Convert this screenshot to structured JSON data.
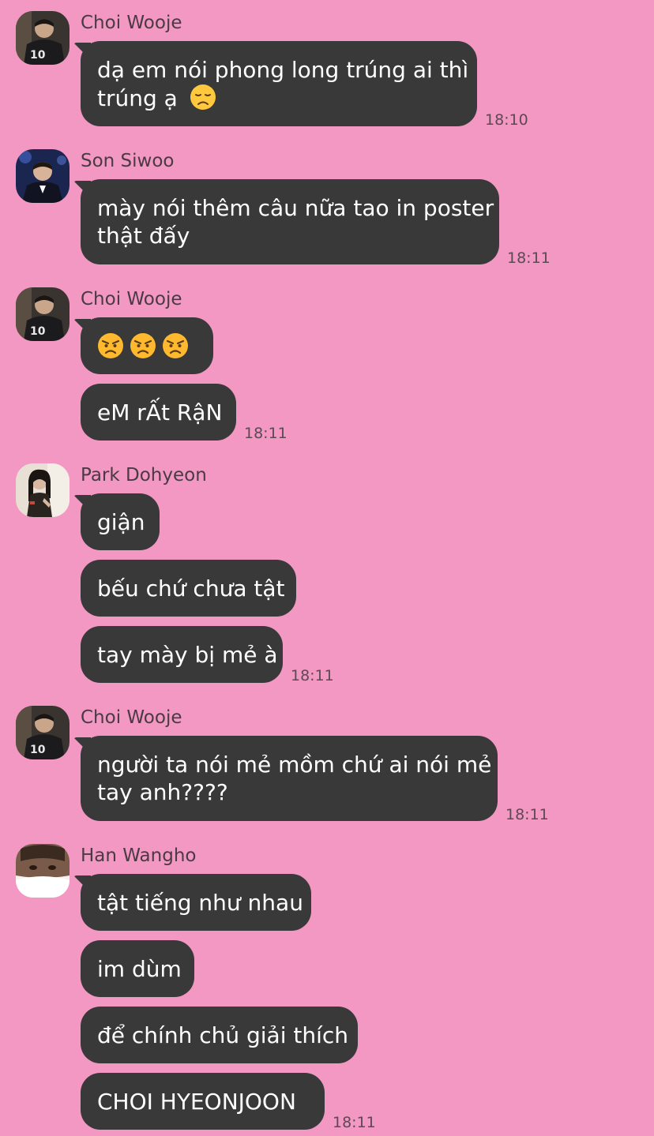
{
  "messages": [
    {
      "sender": "Choi Wooje",
      "avatar": "avatar-choi-wooje",
      "bubbles": [
        {
          "lines": [
            "dạ em nói phong long trúng ai thì",
            "trúng ạ"
          ],
          "emoji": "disappointed-face-emoji"
        }
      ],
      "time": "18:10"
    },
    {
      "sender": "Son Siwoo",
      "avatar": "avatar-son-siwoo",
      "bubbles": [
        {
          "lines": [
            "mày nói thêm câu nữa tao in poster",
            "thật đấy"
          ]
        }
      ],
      "time": "18:11"
    },
    {
      "sender": "Choi Wooje",
      "avatar": "avatar-choi-wooje",
      "bubbles": [
        {
          "lines": [],
          "emoji_row": [
            "angry-face-emoji",
            "angry-face-emoji",
            "angry-face-emoji"
          ]
        },
        {
          "lines": [
            "eM rẤt RậN"
          ]
        }
      ],
      "time": "18:11"
    },
    {
      "sender": "Park Dohyeon",
      "avatar": "avatar-park-dohyeon",
      "bubbles": [
        {
          "lines": [
            "giận"
          ]
        },
        {
          "lines": [
            "bếu chứ chưa tật"
          ]
        },
        {
          "lines": [
            "tay mày bị mẻ à"
          ]
        }
      ],
      "time": "18:11"
    },
    {
      "sender": "Choi Wooje",
      "avatar": "avatar-choi-wooje",
      "bubbles": [
        {
          "lines": [
            "người ta nói mẻ mồm chứ ai nói mẻ",
            "tay anh????"
          ]
        }
      ],
      "time": "18:11"
    },
    {
      "sender": "Han Wangho",
      "avatar": "avatar-han-wangho",
      "bubbles": [
        {
          "lines": [
            "tật tiếng như nhau"
          ]
        },
        {
          "lines": [
            "im dùm"
          ]
        },
        {
          "lines": [
            "để chính chủ giải thích"
          ]
        },
        {
          "lines": [
            "CHOI HYEONJOON"
          ]
        }
      ],
      "time": "18:11"
    }
  ]
}
